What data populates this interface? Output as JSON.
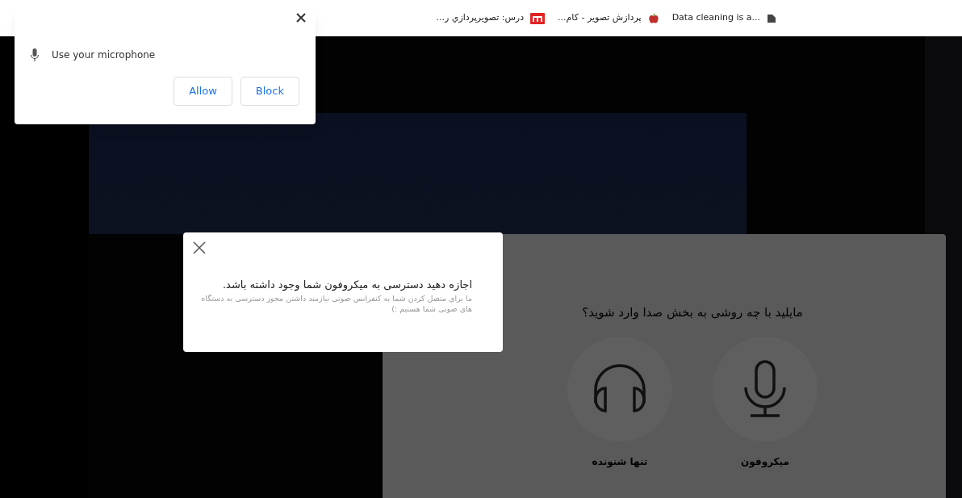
{
  "bookmarks_bar": {
    "items": [
      {
        "label": "Data cleaning is a...",
        "kind": "doc"
      },
      {
        "label": "پردازش تصویر - کام...",
        "kind": "apple"
      },
      {
        "label": "درس: تصویرپردازي ر...",
        "kind": "m"
      }
    ]
  },
  "permission_popup": {
    "message": "Use your microphone",
    "buttons": [
      "Block",
      "Allow"
    ]
  },
  "audio_dialog": {
    "title": "مایلید با چه روشی به بخش صدا وارد شوید؟",
    "options": [
      {
        "label": "میکروفون",
        "kind": "mic"
      },
      {
        "label": "تنها شنونده",
        "kind": "listen"
      }
    ]
  },
  "permission_notice": {
    "title": "اجازه دهید دسترسی به میکروفون شما وجود داشته باشد.",
    "body": "ما برای متصل کردن شما به کنفرانس صوتی نیازمند داشتن مجوز دسترسی به دستگاه های صوتی شما هستیم :)"
  }
}
